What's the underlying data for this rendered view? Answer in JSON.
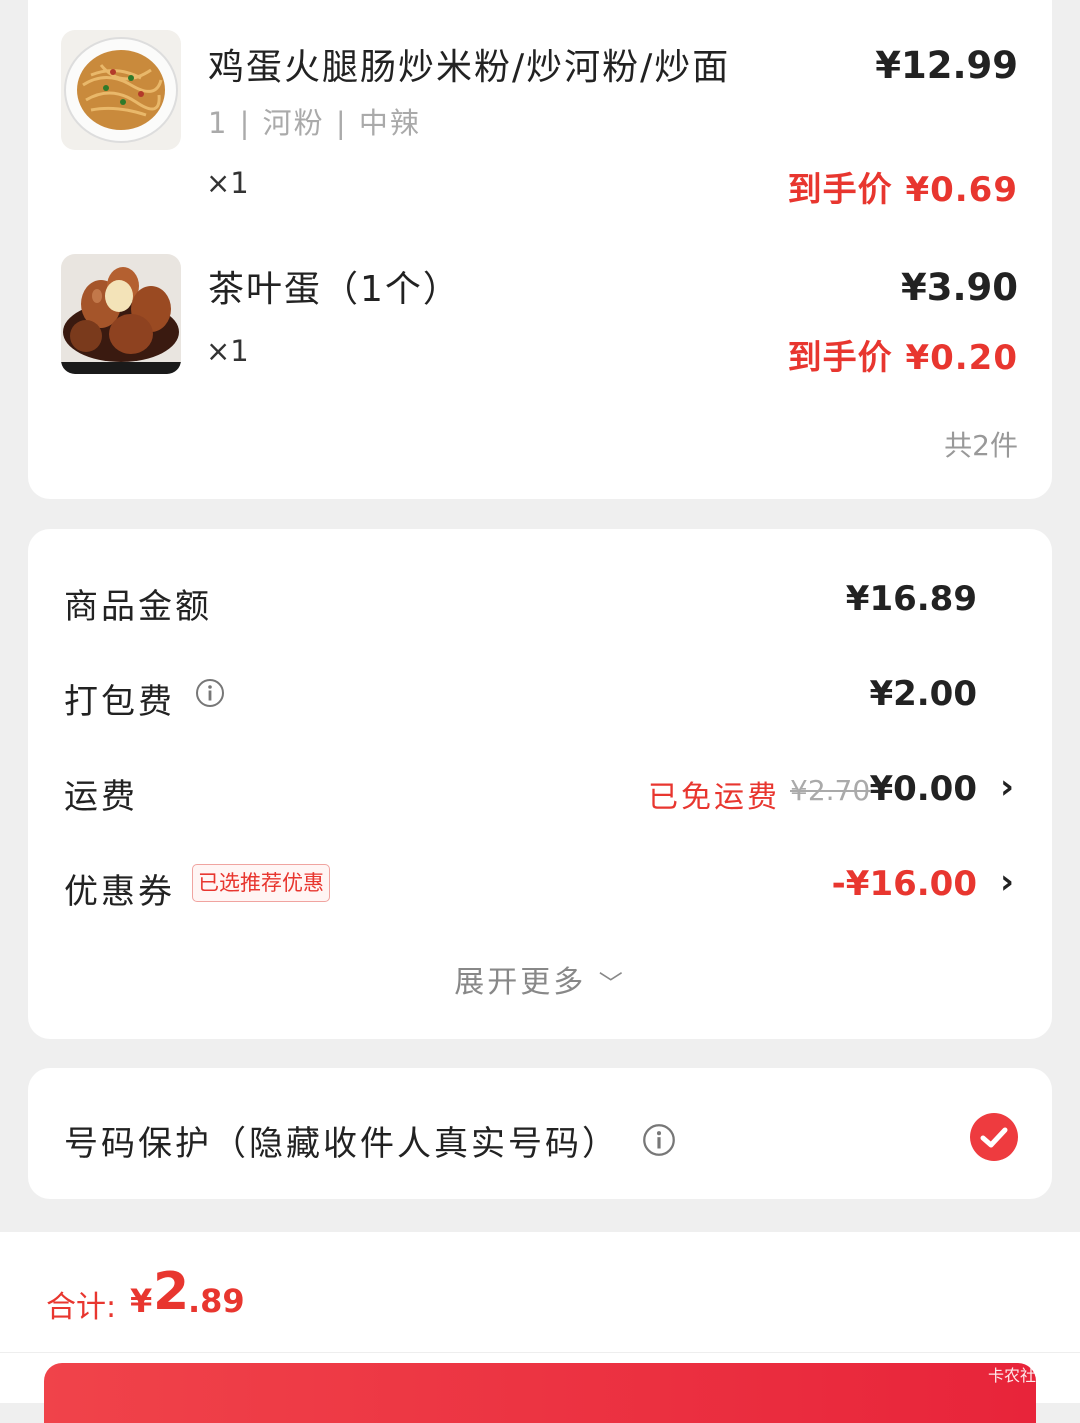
{
  "items": [
    {
      "name": "鸡蛋火腿肠炒米粉/炒河粉/炒面",
      "spec": "1 | 河粉 | 中辣",
      "qty": "×1",
      "price": "¥12.99",
      "final_price": "到手价 ¥0.69",
      "image": "fried-rice-noodles"
    },
    {
      "name": "茶叶蛋（1个）",
      "spec": "",
      "qty": "×1",
      "price": "¥3.90",
      "final_price": "到手价 ¥0.20",
      "image": "tea-eggs"
    }
  ],
  "item_count": "共2件",
  "fees": {
    "goods_label": "商品金额",
    "goods_value": "¥16.89",
    "packing_label": "打包费",
    "packing_value": "¥2.00",
    "shipping_label": "运费",
    "shipping_free_tag": "已免运费",
    "shipping_original": "¥2.70",
    "shipping_value": "¥0.00",
    "coupon_label": "优惠券",
    "coupon_badge": "已选推荐优惠",
    "coupon_value": "-¥16.00",
    "expand_more": "展开更多"
  },
  "privacy": {
    "label": "号码保护（隐藏收件人真实号码）",
    "checked": true
  },
  "footer": {
    "total_label": "合计:",
    "total_currency": "¥",
    "total_integer": "2",
    "total_decimal": ".89",
    "watermark": "卡农社"
  },
  "colors": {
    "accent": "#e8362f",
    "background": "#efefef"
  }
}
